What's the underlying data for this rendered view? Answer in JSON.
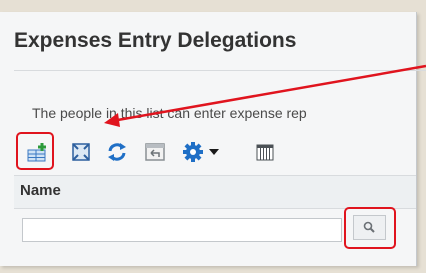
{
  "page": {
    "title": "Expenses Entry Delegations",
    "description": "The people in this list can enter expense rep"
  },
  "toolbar": {
    "buttons": [
      {
        "name": "add-row",
        "icon": "add-row-icon"
      },
      {
        "name": "detach",
        "icon": "detach-icon"
      },
      {
        "name": "refresh",
        "icon": "refresh-icon"
      },
      {
        "name": "revert",
        "icon": "revert-icon"
      },
      {
        "name": "actions",
        "icon": "gear-icon"
      },
      {
        "name": "columns",
        "icon": "columns-icon"
      }
    ]
  },
  "table": {
    "columns": [
      "Name"
    ],
    "filter_value": ""
  },
  "colors": {
    "highlight": "#e0141e",
    "icon_blue": "#1f6fc6",
    "add_green": "#2c9a3a"
  }
}
